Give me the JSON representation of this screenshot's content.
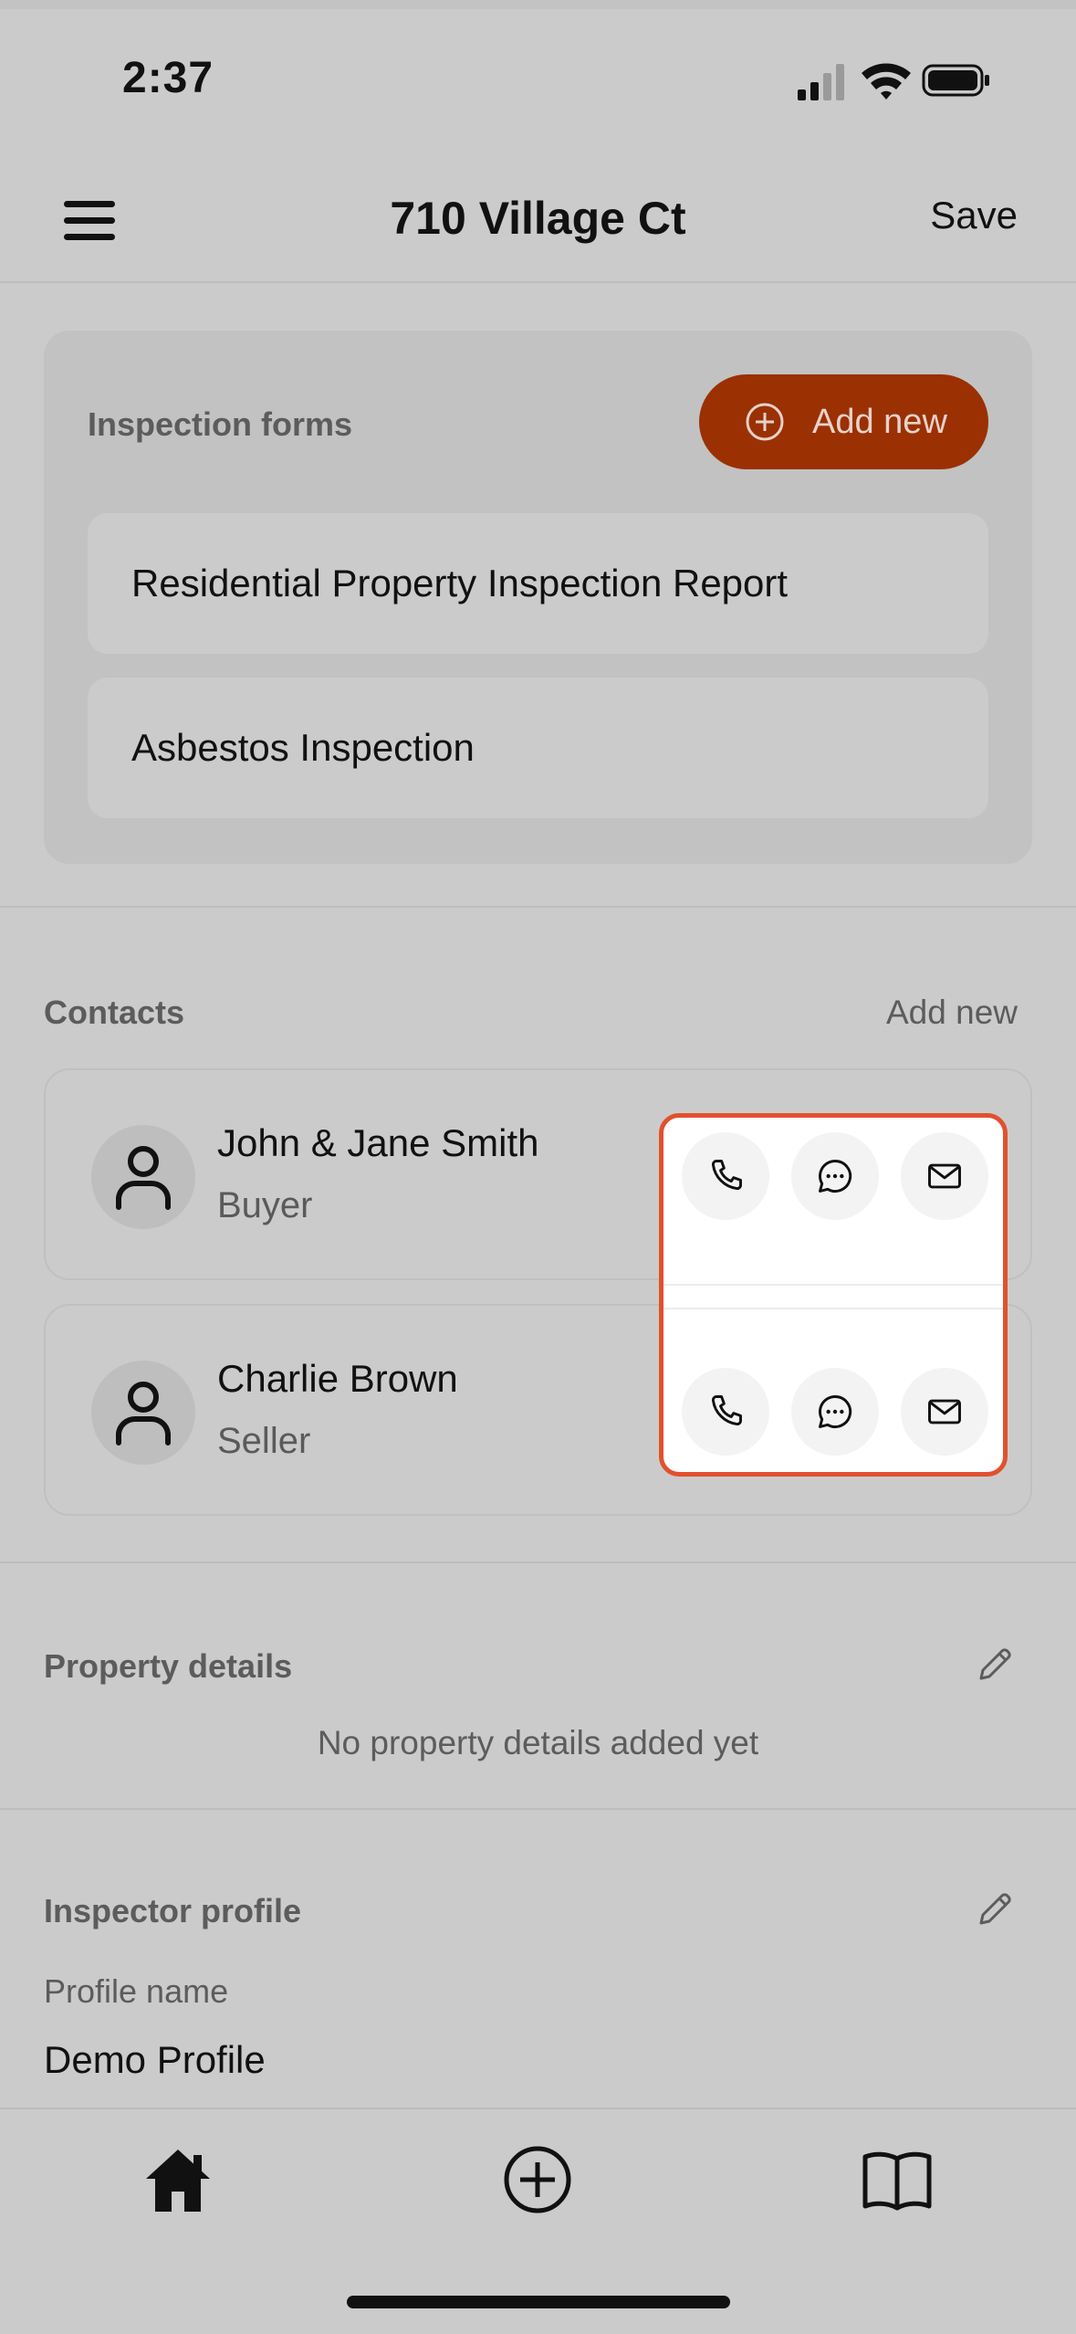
{
  "status_bar": {
    "time": "2:37"
  },
  "header": {
    "title": "710 Village Ct",
    "save_label": "Save"
  },
  "inspection_forms": {
    "label": "Inspection forms",
    "add_label": "Add new",
    "items": [
      "Residential Property Inspection Report",
      "Asbestos Inspection"
    ]
  },
  "contacts": {
    "label": "Contacts",
    "add_label": "Add new",
    "items": [
      {
        "name": "John & Jane Smith",
        "role": "Buyer"
      },
      {
        "name": "Charlie Brown",
        "role": "Seller"
      }
    ]
  },
  "property_details": {
    "label": "Property details",
    "empty_text": "No property details added yet"
  },
  "inspector_profile": {
    "label": "Inspector profile",
    "field_label": "Profile name",
    "field_value": "Demo Profile"
  },
  "colors": {
    "accent": "#9b3003",
    "highlight": "#e2502e",
    "background": "#cbcbcb"
  },
  "icons": [
    "menu-icon",
    "plus-circle-icon",
    "person-icon",
    "phone-icon",
    "chat-icon",
    "mail-icon",
    "pencil-icon",
    "home-icon",
    "add-circle-icon",
    "book-icon"
  ]
}
